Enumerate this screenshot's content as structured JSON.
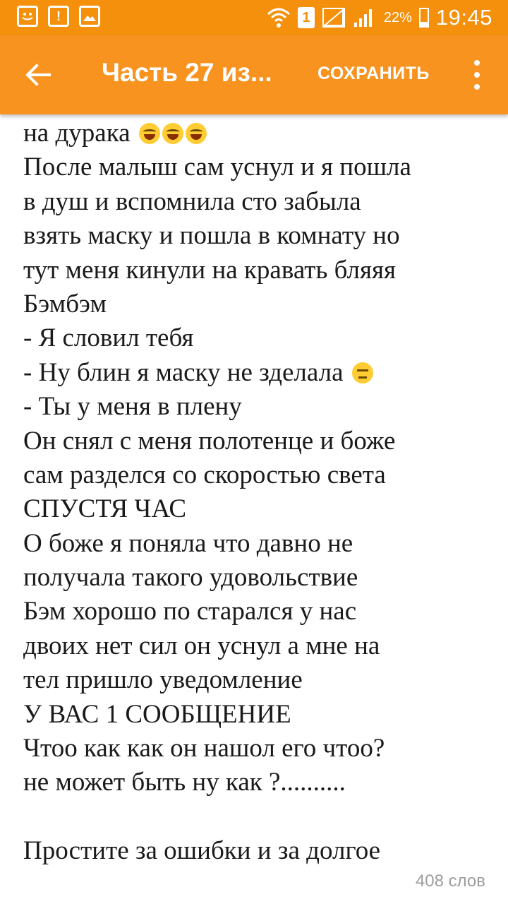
{
  "status_bar": {
    "icons_left": [
      "notification-icon",
      "alert-icon",
      "image-icon"
    ],
    "sim_label": "1",
    "battery_percent": "22%",
    "time": "19:45"
  },
  "app_bar": {
    "title": "Часть 27 из...",
    "save_label": "СОХРАНИТЬ",
    "color": "#f7931e"
  },
  "editor": {
    "lines": [
      {
        "text": "на дурака ",
        "emoji": [
          "laugh",
          "laugh",
          "laugh"
        ]
      },
      {
        "text": "После малыш сам уснул и я пошла"
      },
      {
        "text": "в душ и вспомнила сто забыла"
      },
      {
        "text": "взять маску и пошла в комнату но"
      },
      {
        "text": "тут меня кинули на кравать бляяя"
      },
      {
        "text": "Бэмбэм"
      },
      {
        "text": "- Я словил тебя"
      },
      {
        "text": "- Ну блин я маску не зделала ",
        "emoji": [
          "meh"
        ]
      },
      {
        "text": "- Ты у меня в плену"
      },
      {
        "text": "Он снял с меня полотенце и боже"
      },
      {
        "text": "сам разделся со скоростью света"
      },
      {
        "text": "СПУСТЯ ЧАС"
      },
      {
        "text": "О боже я поняла что давно не"
      },
      {
        "text": "получала такого удовольствие"
      },
      {
        "text": "Бэм хорошо по старался у нас"
      },
      {
        "text": "двоих нет сил он уснул а мне на"
      },
      {
        "text": "тел пришло уведомление"
      },
      {
        "text": "У ВАС 1 СООБЩЕНИЕ"
      },
      {
        "text": "Чтоо как как он нашол его чтоо?"
      },
      {
        "text": "не может быть ну как ?.........."
      },
      {
        "text": ""
      },
      {
        "text": "Простите за ошибки и за долгое"
      }
    ]
  },
  "footer": {
    "word_count": "408 слов"
  }
}
